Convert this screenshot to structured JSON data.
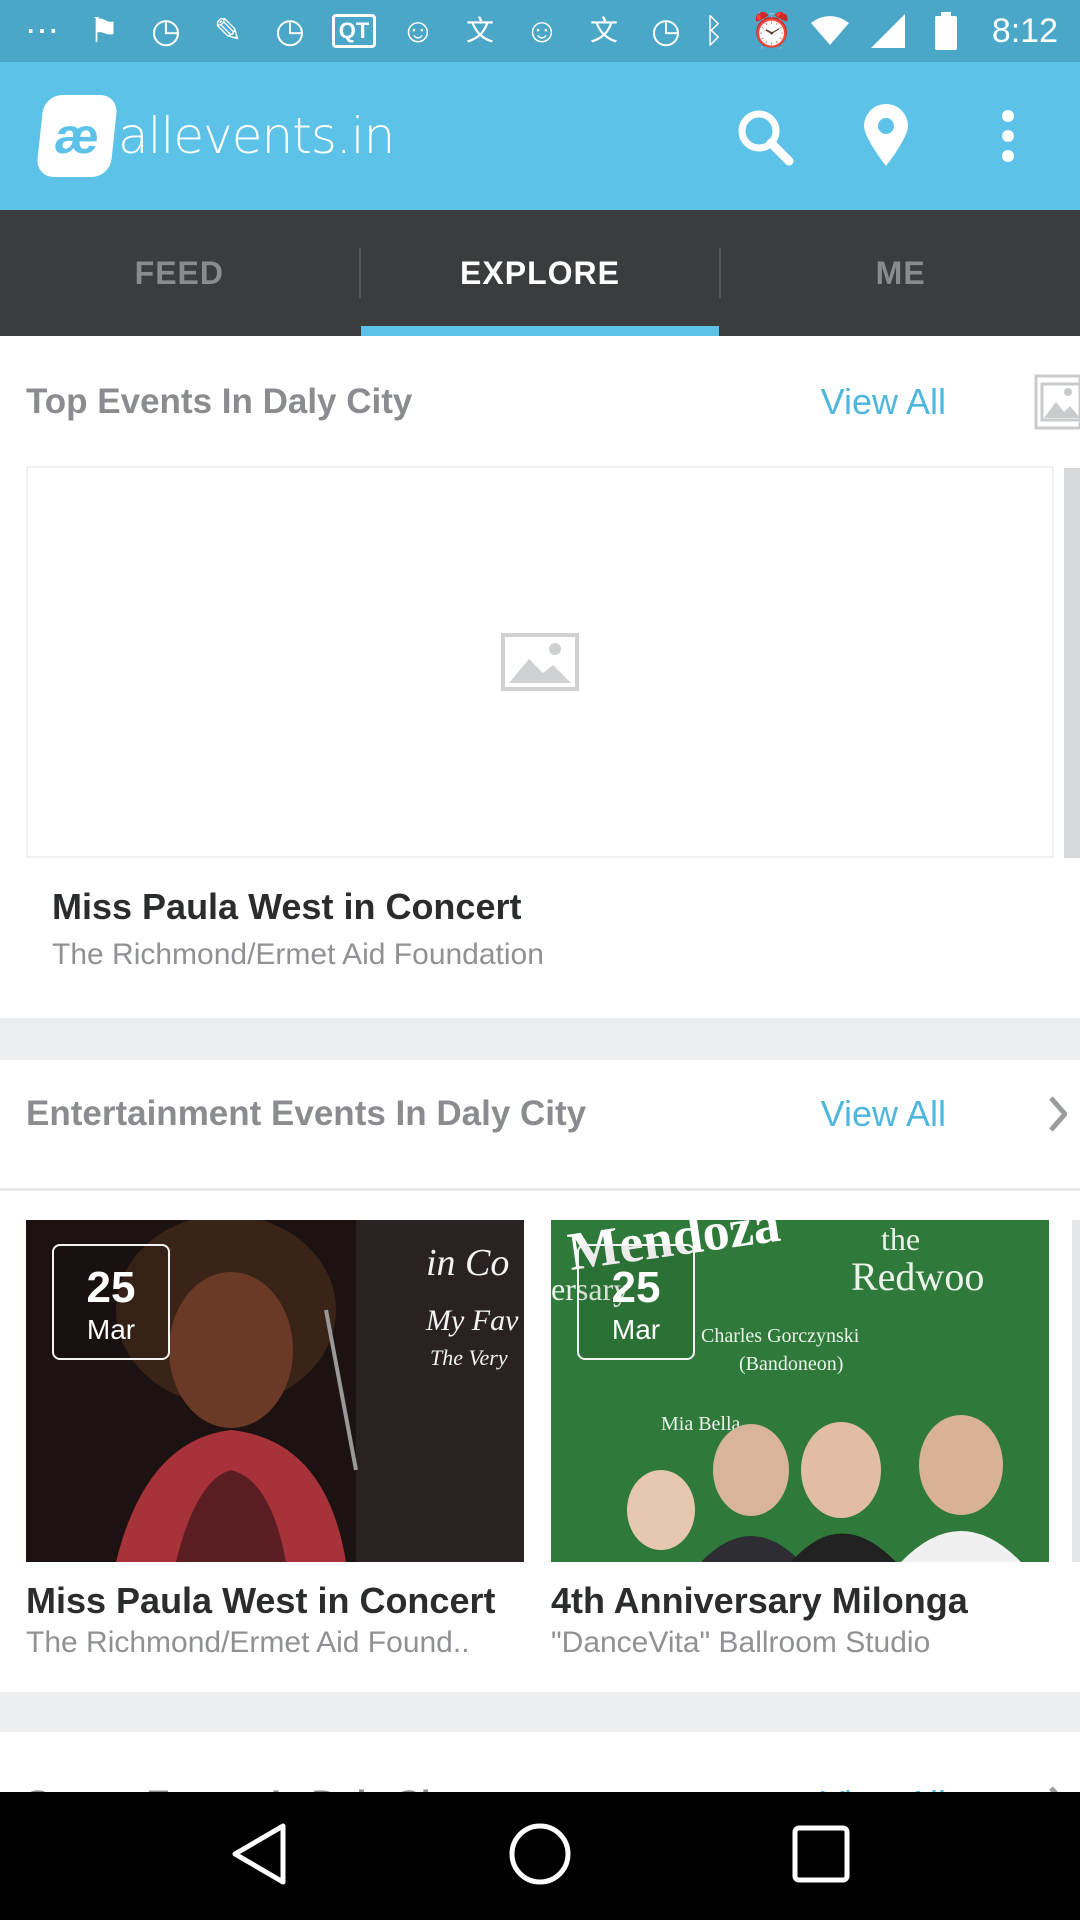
{
  "status_bar": {
    "time": "8:12",
    "left_icons": [
      "more-icon",
      "flag-icon",
      "timer-icon",
      "wrench-icon",
      "timer-icon",
      "qt-icon",
      "smiley-icon",
      "translate-icon",
      "smiley-icon",
      "translate-icon",
      "timer-icon"
    ],
    "right_icons": [
      "bluetooth-icon",
      "alarm-icon",
      "wifi-icon",
      "signal-icon",
      "battery-icon"
    ]
  },
  "app_bar": {
    "logo_badge": "æ",
    "logo_text": "allevents.in",
    "accent_color": "#5dc2e8"
  },
  "tabs": [
    {
      "label": "FEED",
      "active": false
    },
    {
      "label": "EXPLORE",
      "active": true
    },
    {
      "label": "ME",
      "active": false
    }
  ],
  "sections": {
    "top": {
      "title": "Top Events In Daly City",
      "view_all": "View All",
      "event": {
        "title": "Miss Paula West in Concert",
        "venue": "The Richmond/Ermet Aid Foundation"
      }
    },
    "entertainment": {
      "title": "Entertainment Events In Daly City",
      "view_all": "View All",
      "cards": [
        {
          "day": "25",
          "month": "Mar",
          "title": "Miss Paula West in Concert",
          "venue": "The Richmond/Ermet Aid Found.."
        },
        {
          "day": "25",
          "month": "Mar",
          "title": "4th Anniversary Milonga",
          "venue": "\"DanceVita\" Ballroom Studio"
        }
      ]
    },
    "sports": {
      "title": "Sports Events In Daly City",
      "view_all": "View All"
    }
  }
}
